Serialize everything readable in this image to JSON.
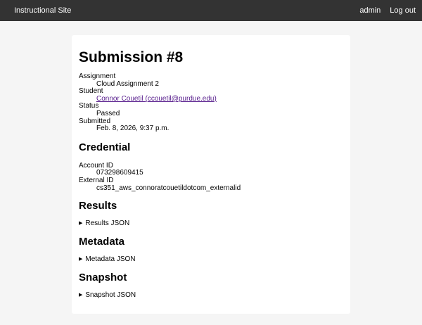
{
  "nav": {
    "site_title": "Instructional Site",
    "user": "admin",
    "logout": "Log out"
  },
  "page": {
    "title": "Submission #8"
  },
  "submission": {
    "assignment_label": "Assignment",
    "assignment_value": "Cloud Assignment 2",
    "student_label": "Student",
    "student_value": "Connor Couetil (ccouetil@purdue.edu)",
    "status_label": "Status",
    "status_value": "Passed",
    "submitted_label": "Submitted",
    "submitted_value": "Feb. 8, 2026, 9:37 p.m."
  },
  "credential": {
    "heading": "Credential",
    "account_label": "Account ID",
    "account_value": "073298609415",
    "external_label": "External ID",
    "external_value": "cs351_aws_connoratcouetildotcom_externalid"
  },
  "results": {
    "heading": "Results",
    "toggle": "Results JSON"
  },
  "metadata": {
    "heading": "Metadata",
    "toggle": "Metadata JSON"
  },
  "snapshot": {
    "heading": "Snapshot",
    "toggle": "Snapshot JSON"
  },
  "icons": {
    "disclosure": "disclosure-triangle-icon"
  },
  "colors": {
    "topbar": "#333333",
    "background": "#f5f5f5",
    "link": "#551a8b"
  }
}
